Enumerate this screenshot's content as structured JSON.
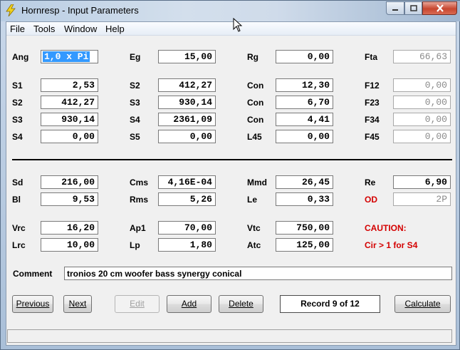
{
  "window": {
    "title": "Hornresp - Input Parameters"
  },
  "menu": [
    "File",
    "Tools",
    "Window",
    "Help"
  ],
  "params": {
    "ang": {
      "label": "Ang",
      "value": "1,0 x Pi"
    },
    "eg": {
      "label": "Eg",
      "value": "15,00"
    },
    "rg": {
      "label": "Rg",
      "value": "0,00"
    },
    "fta": {
      "label": "Fta",
      "value": "66,63"
    },
    "s1a": {
      "label": "S1",
      "value": "2,53"
    },
    "s2a": {
      "label": "S2",
      "value": "412,27"
    },
    "con1": {
      "label": "Con",
      "value": "12,30"
    },
    "f12": {
      "label": "F12",
      "value": "0,00"
    },
    "s2b": {
      "label": "S2",
      "value": "412,27"
    },
    "s3a": {
      "label": "S3",
      "value": "930,14"
    },
    "con2": {
      "label": "Con",
      "value": "6,70"
    },
    "f23": {
      "label": "F23",
      "value": "0,00"
    },
    "s3b": {
      "label": "S3",
      "value": "930,14"
    },
    "s4a": {
      "label": "S4",
      "value": "2361,09"
    },
    "con3": {
      "label": "Con",
      "value": "4,41"
    },
    "f34": {
      "label": "F34",
      "value": "0,00"
    },
    "s4b": {
      "label": "S4",
      "value": "0,00"
    },
    "s5": {
      "label": "S5",
      "value": "0,00"
    },
    "l45": {
      "label": "L45",
      "value": "0,00"
    },
    "f45": {
      "label": "F45",
      "value": "0,00"
    },
    "sd": {
      "label": "Sd",
      "value": "216,00"
    },
    "cms": {
      "label": "Cms",
      "value": "4,16E-04"
    },
    "mmd": {
      "label": "Mmd",
      "value": "26,45"
    },
    "re": {
      "label": "Re",
      "value": "6,90"
    },
    "bl": {
      "label": "Bl",
      "value": "9,53"
    },
    "rms": {
      "label": "Rms",
      "value": "5,26"
    },
    "le": {
      "label": "Le",
      "value": "0,33"
    },
    "od": {
      "label": "OD",
      "value": "2P"
    },
    "vrc": {
      "label": "Vrc",
      "value": "16,20"
    },
    "ap1": {
      "label": "Ap1",
      "value": "70,00"
    },
    "vtc": {
      "label": "Vtc",
      "value": "750,00"
    },
    "lrc": {
      "label": "Lrc",
      "value": "10,00"
    },
    "lp": {
      "label": "Lp",
      "value": "1,80"
    },
    "atc": {
      "label": "Atc",
      "value": "125,00"
    }
  },
  "caution": {
    "title": "CAUTION:",
    "message": "Cir > 1 for S4"
  },
  "comment": {
    "label": "Comment",
    "value": "tronios 20 cm woofer bass synergy  conical"
  },
  "buttons": {
    "previous": "Previous",
    "next": "Next",
    "edit": "Edit",
    "add": "Add",
    "delete": "Delete",
    "record": "Record 9 of 12",
    "calculate": "Calculate"
  },
  "colors": {
    "label": "#000000",
    "warning": "#d40000",
    "selection": "#3399ff"
  }
}
